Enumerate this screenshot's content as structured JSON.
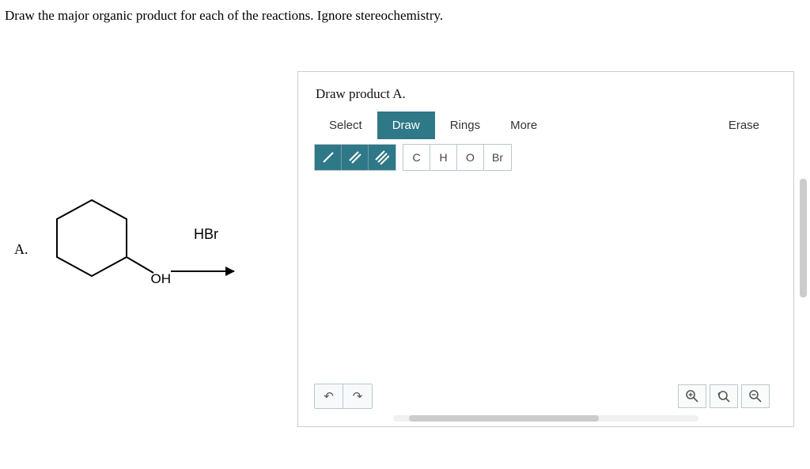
{
  "question": "Draw the major organic product for each of the reactions. Ignore stereochemistry.",
  "part": {
    "label": "A.",
    "reagent": "HBr",
    "substituent": "OH"
  },
  "editor": {
    "title": "Draw product A.",
    "tabs": {
      "select": "Select",
      "draw": "Draw",
      "rings": "Rings",
      "more": "More",
      "erase": "Erase"
    },
    "elements": {
      "c": "C",
      "h": "H",
      "o": "O",
      "br": "Br"
    }
  }
}
